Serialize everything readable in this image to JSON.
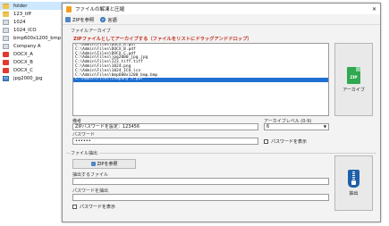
{
  "explorer": {
    "items": [
      {
        "label": "folder",
        "icon": "folder-icon"
      },
      {
        "label": "123_tiff",
        "icon": "folder-icon"
      },
      {
        "label": "1024",
        "icon": "file-icon"
      },
      {
        "label": "1024_ICO",
        "icon": "file-icon"
      },
      {
        "label": "bmp600x1200_bmp",
        "icon": "file-icon"
      },
      {
        "label": "Company A",
        "icon": "file-icon"
      },
      {
        "label": "DOCX_A",
        "icon": "pdf-icon"
      },
      {
        "label": "DOCX_B",
        "icon": "pdf-icon"
      },
      {
        "label": "DOCX_C",
        "icon": "pdf-icon"
      },
      {
        "label": "jpg2000_jpg",
        "icon": "image-icon"
      }
    ],
    "selected_index": 0
  },
  "window": {
    "title": "ファイルの解凍と圧縮",
    "close_glyph": "✕"
  },
  "toolbar": {
    "zip_ref_label": "ZIPを参照",
    "language_label": "言語"
  },
  "archive": {
    "section_label": "ファイルアーカイブ",
    "hint": "ZIPファイルとしてアーカイブする（ファイルをリストにドラッグアンドドロップ）",
    "files": [
      "C:\\Admin\\Files\\DOCX_A.pdf",
      "C:\\Admin\\Files\\DOCX_B.pdf",
      "C:\\Admin\\Files\\DOCX_C.pdf",
      "C:\\Admin\\Files\\jpg2000_jpg.jpg",
      "C:\\Admin\\Files\\123_tiff.tiff",
      "C:\\Admin\\Files\\1024.png",
      "C:\\Admin\\Files\\1024_ICO.ico",
      "C:\\Admin\\Files\\bmp600x1200_bmp.bmp",
      "C:\\Admin\\Files\\Company A.pdf"
    ],
    "selected_index": 8,
    "archive_button_label": "アーカイブ",
    "zip_icon_text": "ZIP"
  },
  "settings": {
    "comment_label": "備考",
    "comment_value": "ZIPパスワードを設定：123456",
    "level_label": "アーカイブレベル (0-9)",
    "level_value": "6",
    "password_label": "パスワード",
    "password_value": "••••••",
    "show_password_label": "パスワードを表示"
  },
  "extract": {
    "section_label": "ファイル抽出",
    "zip_ref_label": "ZIPを参照",
    "target_label": "抽出するファイル",
    "target_value": "",
    "password_label": "パスワードを抽出",
    "password_value": "",
    "show_password_label": "パスワードを表示",
    "extract_button_label": "抽出"
  }
}
